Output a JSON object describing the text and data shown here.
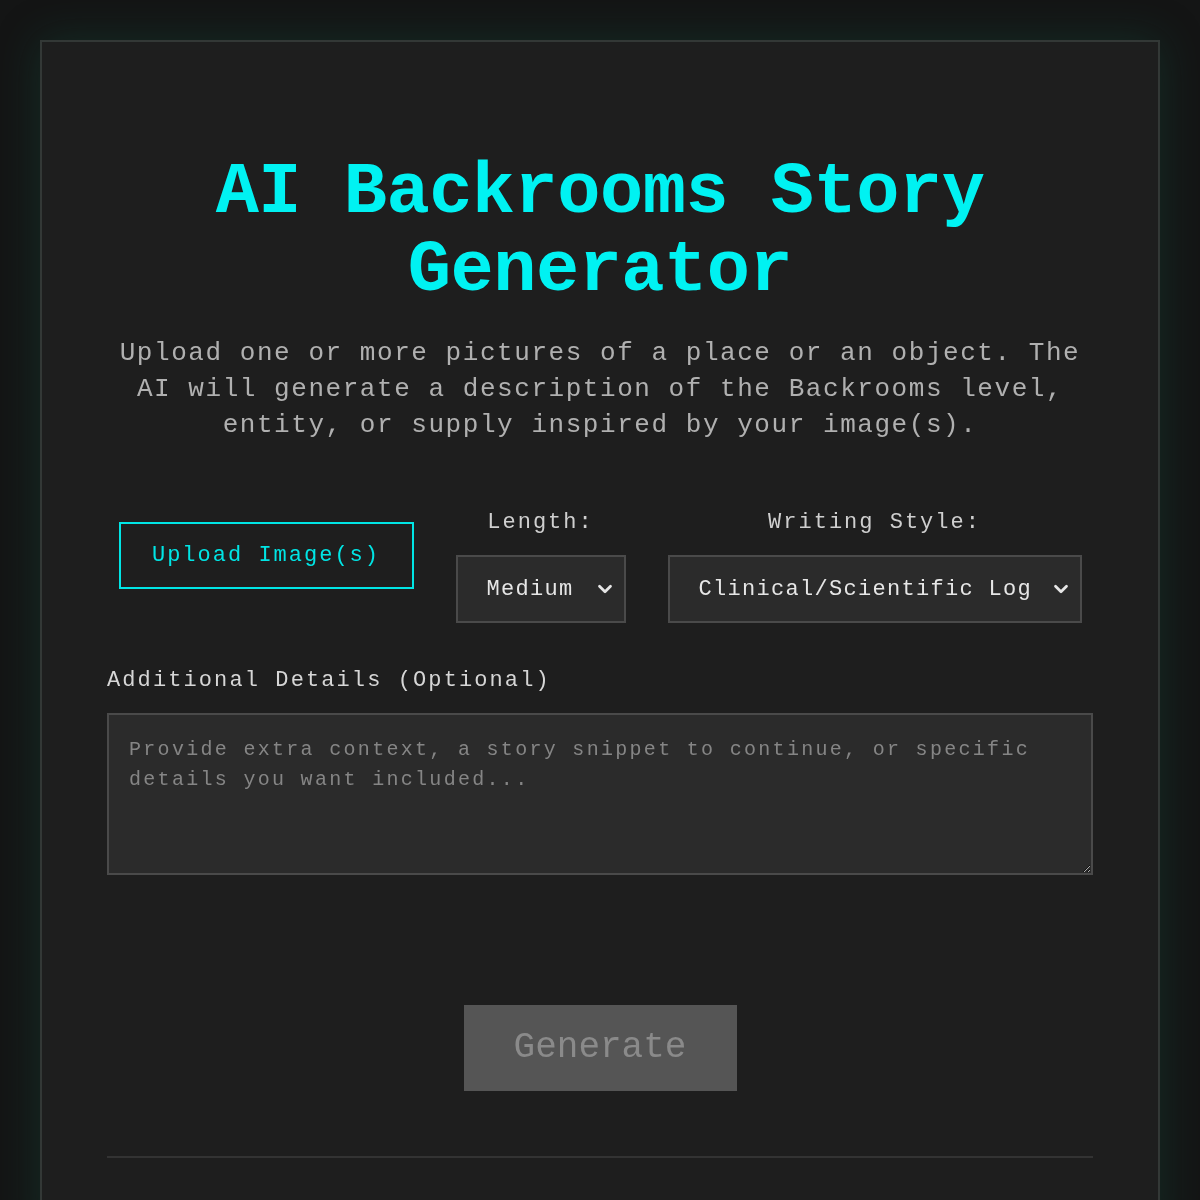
{
  "title": "AI Backrooms Story Generator",
  "description": "Upload one or more pictures of a place or an object. The AI will generate a description of the Backrooms level, entity, or supply inspired by your image(s).",
  "upload_button": {
    "label": "Upload Image(s)"
  },
  "length": {
    "label": "Length:",
    "value": "Medium"
  },
  "writing_style": {
    "label": "Writing Style:",
    "value": "Clinical/Scientific Log"
  },
  "details": {
    "label": "Additional Details (Optional)",
    "placeholder": "Provide extra context, a story snippet to continue, or specific details you want included..."
  },
  "generate_button": {
    "label": "Generate",
    "disabled": true
  }
}
